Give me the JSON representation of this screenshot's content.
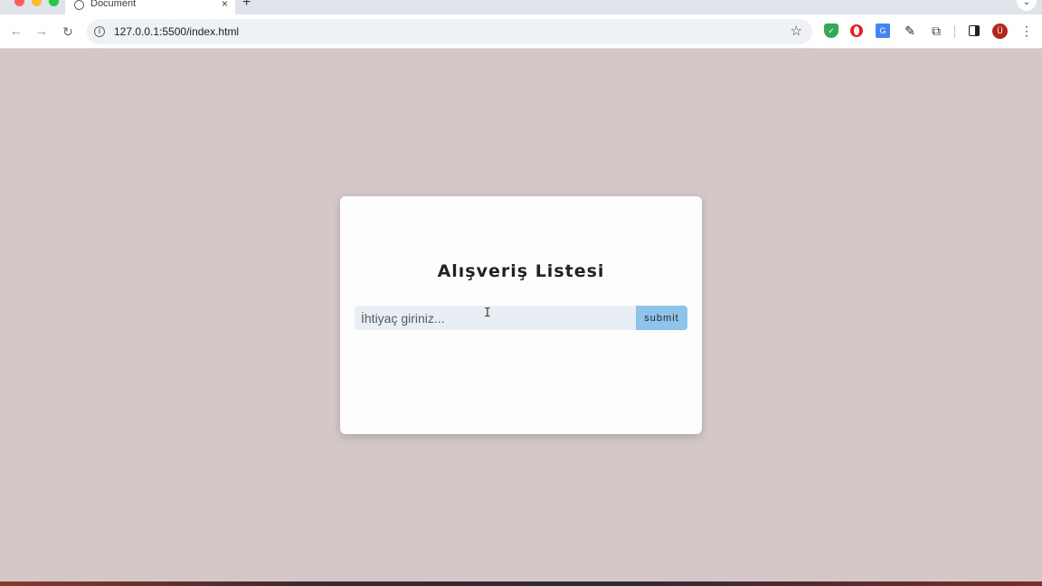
{
  "browser": {
    "tab_title": "Document",
    "tab_close": "×",
    "new_tab": "+",
    "tab_dropdown": "⌄",
    "url": "127.0.0.1:5500/index.html",
    "nav": {
      "back": "←",
      "forward": "→",
      "reload": "↻"
    },
    "icons": {
      "star": "☆",
      "pen": "✎",
      "puzzle": "⧉",
      "menu": "⋮",
      "info": "i",
      "shield": "✓",
      "translate": "G"
    },
    "profile_initial": "Ü"
  },
  "card": {
    "title": "Alışveriş Listesi",
    "input_placeholder": "İhtiyaç giriniz...",
    "input_value": "",
    "submit_label": "submit",
    "cursor_glyph": "I"
  },
  "colors": {
    "page_background": "#d3c8c7",
    "card_background": "#fdfdfd",
    "input_background": "#e9eef4",
    "submit_background": "#8fc4ea"
  }
}
